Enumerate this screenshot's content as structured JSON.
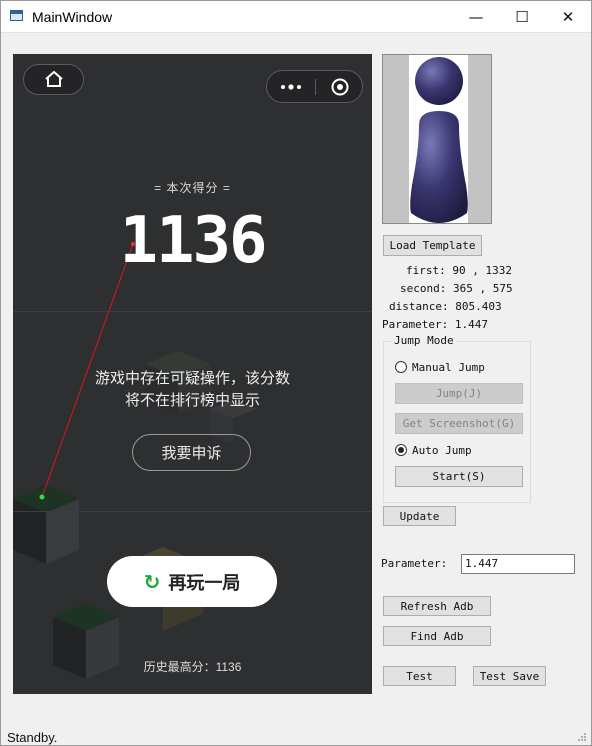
{
  "window": {
    "title": "MainWindow",
    "minimize_glyph": "—",
    "maximize_glyph": "☐",
    "close_glyph": "✕"
  },
  "game": {
    "score_caption": "= 本次得分 =",
    "score": "1136",
    "warning_line1": "游戏中存在可疑操作，该分数",
    "warning_line2": "将不在排行榜中显示",
    "appeal_label": "我要申诉",
    "replay_label": "再玩一局",
    "best_score": "历史最高分：1136",
    "accent_color": "#21a63a",
    "icons": [
      "home-icon",
      "more-dots-icon",
      "target-icon",
      "replay-icon"
    ]
  },
  "panel": {
    "load_template_label": "Load Template",
    "first_text": "first: 90 , 1332",
    "second_text": "second: 365 , 575",
    "distance_text": "distance: 805.403",
    "parameter_text": "Parameter: 1.447",
    "jump_mode_title": "Jump Mode",
    "manual_jump_label": "Manual Jump",
    "jump_button_label": "Jump(J)",
    "get_screenshot_label": "Get Screenshot(G)",
    "auto_jump_label": "Auto Jump",
    "start_label": "Start(S)",
    "update_label": "Update",
    "parameter_label": "Parameter:",
    "parameter_value": "1.447",
    "refresh_adb_label": "Refresh Adb",
    "find_adb_label": "Find Adb",
    "test_label": "Test",
    "test_save_label": "Test Save"
  },
  "status": {
    "text": "Standby."
  }
}
